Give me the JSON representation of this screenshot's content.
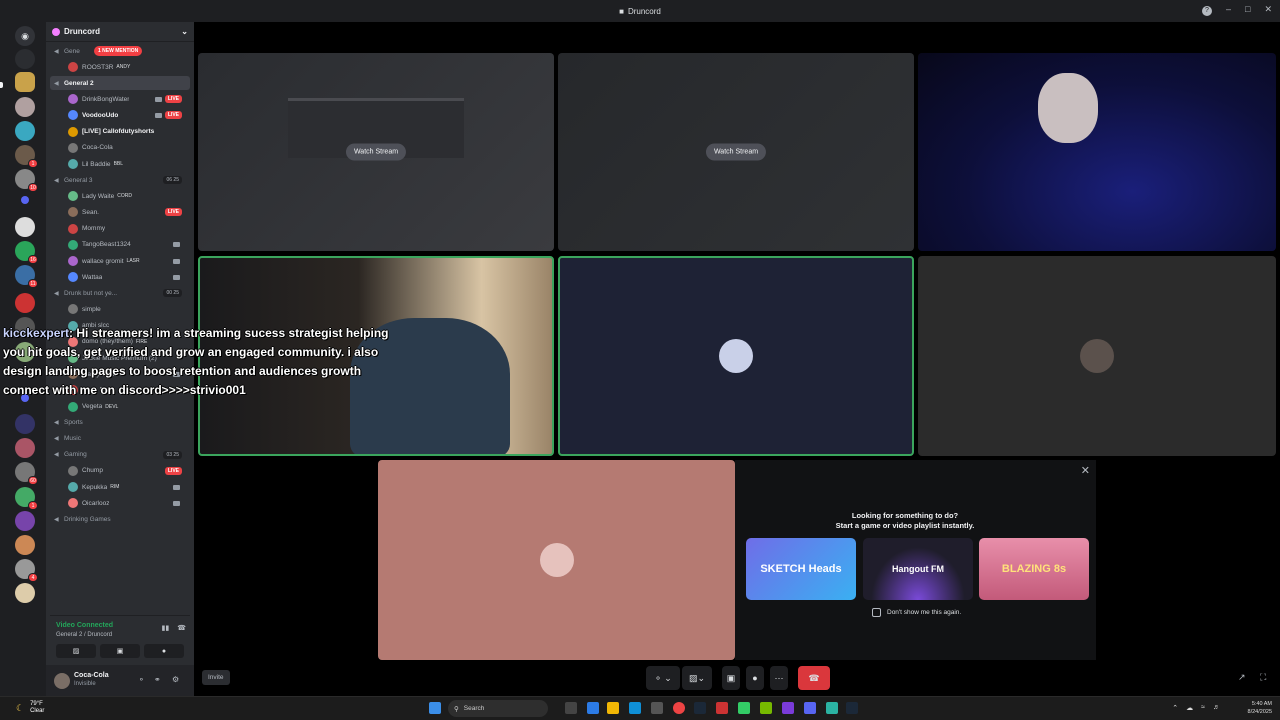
{
  "window": {
    "title": "Druncord"
  },
  "server": {
    "name": "Druncord",
    "mention_badge": "1 NEW MENTION"
  },
  "channels": [
    {
      "type": "vc",
      "name": "Gene",
      "active": false
    },
    {
      "type": "user",
      "name": "ROOST3R",
      "tag": "ANDY"
    },
    {
      "type": "vc",
      "name": "General 2",
      "active": true
    },
    {
      "type": "user",
      "name": "DrinkBongWater",
      "live": "LIVE",
      "cam": true
    },
    {
      "type": "user",
      "name": "VoodooUdo",
      "live": "LIVE",
      "cam": true,
      "bold": true
    },
    {
      "type": "user",
      "name": "[LIVE] Callofdutyshorts",
      "bold": true
    },
    {
      "type": "user",
      "name": "Coca-Cola"
    },
    {
      "type": "user",
      "name": "Lil Baddie",
      "tag": "BBL"
    },
    {
      "type": "vc",
      "name": "General 3",
      "count": "06  25"
    },
    {
      "type": "user",
      "name": "Lady Waite",
      "tag": "CORD"
    },
    {
      "type": "user",
      "name": "Sean.",
      "live": "LIVE"
    },
    {
      "type": "user",
      "name": "Mommy"
    },
    {
      "type": "user",
      "name": "TangoBeast1324",
      "cam": true
    },
    {
      "type": "user",
      "name": "wallace gromit",
      "tag": "LASR",
      "cam": true
    },
    {
      "type": "user",
      "name": "Wattaa",
      "cam": true
    },
    {
      "type": "vc",
      "name": "Drunk but not ye...",
      "count": "00  25"
    },
    {
      "type": "user",
      "name": "simple"
    },
    {
      "type": "user",
      "name": "ambi slcc"
    },
    {
      "type": "user",
      "name": "domo (they/them)",
      "tag": "FIRE"
    },
    {
      "type": "user",
      "name": "Jockie Music Premium (2)"
    },
    {
      "type": "user",
      "name": "Marky Mark",
      "cam": true
    },
    {
      "type": "user",
      "name": "Nozz",
      "tag": "BF"
    },
    {
      "type": "user",
      "name": "Vegeta",
      "tag": "DEVL"
    },
    {
      "type": "vc",
      "name": "Sports"
    },
    {
      "type": "vc",
      "name": "Music"
    },
    {
      "type": "vc",
      "name": "Gaming",
      "count": "03  25"
    },
    {
      "type": "user",
      "name": "Chump",
      "live": "LIVE"
    },
    {
      "type": "user",
      "name": "Kepukka",
      "tag": "RIM",
      "cam": true
    },
    {
      "type": "user",
      "name": "Oicarlooz",
      "cam": true
    },
    {
      "type": "vc",
      "name": "Drinking Games"
    }
  ],
  "voice": {
    "status": "Video Connected",
    "location": "General 2 / Druncord"
  },
  "user": {
    "name": "Coca-Cola",
    "status": "Invisible"
  },
  "stage": {
    "watch_stream_label": "Watch Stream",
    "invite_label": "Invite"
  },
  "chat_overlay": {
    "author": "kicckexpert",
    "lines": [
      ": Hi streamers! im a streaming sucess strategist helping",
      "you hit goals, get verified and grow an engaged community. i also",
      "design landing pages to boost retention and audiences growth",
      "connect with me on discord>>>>strivio001"
    ]
  },
  "activity": {
    "title_line1": "Looking for something to do?",
    "title_line2": "Start a game or video playlist instantly.",
    "cards": [
      "SKETCH Heads",
      "Hangout FM",
      "BLAZING 8s"
    ],
    "dont_show": "Don't show me this again."
  },
  "taskbar": {
    "temp": "79°F",
    "weather": "Clear",
    "search": "Search",
    "time": "5:40 AM",
    "date": "8/24/2025"
  },
  "colors": {
    "speaking": "#3ba55d",
    "live": "#ed4245",
    "connected": "#23a55a",
    "blurple": "#5865f2"
  }
}
